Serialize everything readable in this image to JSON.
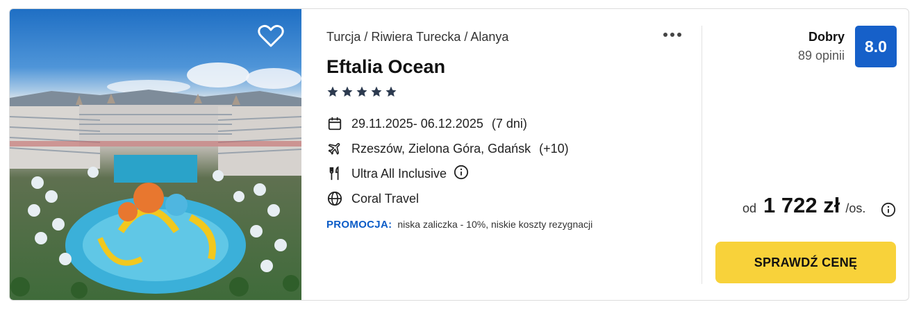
{
  "card": {
    "breadcrumb": "Turcja / Riwiera Turecka / Alanya",
    "hotel_name": "Eftalia Ocean",
    "stars": 5,
    "dates": "29.11.2025- 06.12.2025",
    "duration": "(7 dni)",
    "departures": "Rzeszów, Zielona Góra, Gdańsk",
    "departures_extra": "(+10)",
    "board": "Ultra All Inclusive",
    "operator": "Coral Travel",
    "promo_label": "PROMOCJA:",
    "promo_text": "niska zaliczka - 10%, niskie koszty rezygnacji"
  },
  "rating": {
    "label": "Dobry",
    "reviews": "89 opinii",
    "score": "8.0"
  },
  "price": {
    "prefix": "od",
    "amount": "1 722 zł",
    "suffix": "/os."
  },
  "cta_label": "SPRAWDŹ CENĘ",
  "icons": {
    "favorite": "heart-outline-icon",
    "more": "more-dots-icon",
    "calendar": "calendar-icon",
    "plane": "plane-icon",
    "board": "cutlery-icon",
    "operator": "globe-icon",
    "info": "info-icon"
  },
  "colors": {
    "accent_blue": "#1660c9",
    "promo_blue": "#0b5cc7",
    "cta_yellow": "#f8d23a",
    "star_color": "#2c3a4f"
  }
}
